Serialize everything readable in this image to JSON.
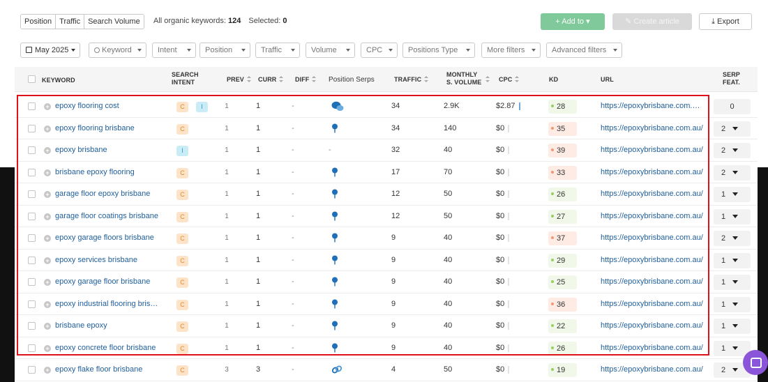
{
  "toolbar": {
    "tabs": [
      "Position",
      "Traffic",
      "Search Volume"
    ],
    "all_keywords_label": "All organic keywords:",
    "all_keywords_count": "124",
    "selected_label": "Selected:",
    "selected_count": "0",
    "add_label": "+ Add to ▾",
    "create_label": "✎ Create article",
    "export_label": "⤓ Export"
  },
  "filters": {
    "date": "May 2025",
    "keyword": "Keyword",
    "intent": "Intent",
    "position": "Position",
    "traffic": "Traffic",
    "volume": "Volume",
    "cpc": "CPC",
    "positions_type": "Positions Type",
    "more": "More filters",
    "advanced": "Advanced filters"
  },
  "columns": {
    "keyword": "KEYWORD",
    "intent_1": "SEARCH",
    "intent_2": "INTENT",
    "prev": "PREV",
    "curr": "CURR",
    "diff": "DIFF",
    "serps": "Position Serps",
    "traffic": "TRAFFIC",
    "volume_1": "MONTHLY",
    "volume_2": "S. VOLUME",
    "cpc": "CPC",
    "kd": "KD",
    "url": "URL",
    "serp_1": "SERP",
    "serp_2": "FEAT."
  },
  "rows": [
    {
      "keyword": "epoxy flooring cost",
      "intents": [
        "C",
        "I"
      ],
      "prev": "1",
      "curr": "1",
      "diff": "-",
      "serp_icon": "chat-icon",
      "traffic": "34",
      "volume": "2.9K",
      "cpc": "$2.87",
      "kd": "28",
      "kd_level": "g",
      "url": "https://epoxybrisbane.com.au/...",
      "serp_features": "0"
    },
    {
      "keyword": "epoxy flooring brisbane",
      "intents": [
        "C"
      ],
      "prev": "1",
      "curr": "1",
      "diff": "-",
      "serp_icon": "pin-icon",
      "traffic": "34",
      "volume": "140",
      "cpc": "$0",
      "kd": "35",
      "kd_level": "r",
      "url": "https://epoxybrisbane.com.au/",
      "serp_features": "2"
    },
    {
      "keyword": "epoxy brisbane",
      "intents": [
        "I"
      ],
      "prev": "1",
      "curr": "1",
      "diff": "-",
      "serp_icon": "none",
      "traffic": "32",
      "volume": "40",
      "cpc": "$0",
      "kd": "39",
      "kd_level": "r",
      "url": "https://epoxybrisbane.com.au/",
      "serp_features": "2"
    },
    {
      "keyword": "brisbane epoxy flooring",
      "intents": [
        "C"
      ],
      "prev": "1",
      "curr": "1",
      "diff": "-",
      "serp_icon": "pin-icon",
      "traffic": "17",
      "volume": "70",
      "cpc": "$0",
      "kd": "33",
      "kd_level": "r",
      "url": "https://epoxybrisbane.com.au/",
      "serp_features": "2"
    },
    {
      "keyword": "garage floor epoxy brisbane",
      "intents": [
        "C"
      ],
      "prev": "1",
      "curr": "1",
      "diff": "-",
      "serp_icon": "pin-icon",
      "traffic": "12",
      "volume": "50",
      "cpc": "$0",
      "kd": "26",
      "kd_level": "g",
      "url": "https://epoxybrisbane.com.au/",
      "serp_features": "1"
    },
    {
      "keyword": "garage floor coatings brisbane",
      "intents": [
        "C"
      ],
      "prev": "1",
      "curr": "1",
      "diff": "-",
      "serp_icon": "pin-icon",
      "traffic": "12",
      "volume": "50",
      "cpc": "$0",
      "kd": "27",
      "kd_level": "g",
      "url": "https://epoxybrisbane.com.au/",
      "serp_features": "1"
    },
    {
      "keyword": "epoxy garage floors brisbane",
      "intents": [
        "C"
      ],
      "prev": "1",
      "curr": "1",
      "diff": "-",
      "serp_icon": "pin-icon",
      "traffic": "9",
      "volume": "40",
      "cpc": "$0",
      "kd": "37",
      "kd_level": "r",
      "url": "https://epoxybrisbane.com.au/",
      "serp_features": "2"
    },
    {
      "keyword": "epoxy services brisbane",
      "intents": [
        "C"
      ],
      "prev": "1",
      "curr": "1",
      "diff": "-",
      "serp_icon": "pin-icon",
      "traffic": "9",
      "volume": "40",
      "cpc": "$0",
      "kd": "29",
      "kd_level": "g",
      "url": "https://epoxybrisbane.com.au/",
      "serp_features": "1"
    },
    {
      "keyword": "epoxy garage floor brisbane",
      "intents": [
        "C"
      ],
      "prev": "1",
      "curr": "1",
      "diff": "-",
      "serp_icon": "pin-icon",
      "traffic": "9",
      "volume": "40",
      "cpc": "$0",
      "kd": "25",
      "kd_level": "g",
      "url": "https://epoxybrisbane.com.au/",
      "serp_features": "1"
    },
    {
      "keyword": "epoxy industrial flooring brisbane",
      "intents": [
        "C"
      ],
      "prev": "1",
      "curr": "1",
      "diff": "-",
      "serp_icon": "pin-icon",
      "traffic": "9",
      "volume": "40",
      "cpc": "$0",
      "kd": "36",
      "kd_level": "r",
      "url": "https://epoxybrisbane.com.au/",
      "serp_features": "1"
    },
    {
      "keyword": "brisbane epoxy",
      "intents": [
        "C"
      ],
      "prev": "1",
      "curr": "1",
      "diff": "-",
      "serp_icon": "pin-icon",
      "traffic": "9",
      "volume": "40",
      "cpc": "$0",
      "kd": "22",
      "kd_level": "g",
      "url": "https://epoxybrisbane.com.au/",
      "serp_features": "1"
    },
    {
      "keyword": "epoxy concrete floor brisbane",
      "intents": [
        "C"
      ],
      "prev": "1",
      "curr": "1",
      "diff": "-",
      "serp_icon": "pin-icon",
      "traffic": "9",
      "volume": "40",
      "cpc": "$0",
      "kd": "26",
      "kd_level": "g",
      "url": "https://epoxybrisbane.com.au/",
      "serp_features": "1"
    },
    {
      "keyword": "epoxy flake floor brisbane",
      "intents": [
        "C"
      ],
      "prev": "3",
      "curr": "3",
      "diff": "-",
      "serp_icon": "link-icon",
      "traffic": "4",
      "volume": "50",
      "cpc": "$0",
      "kd": "19",
      "kd_level": "g",
      "url": "https://epoxybrisbane.com.au/",
      "serp_features": "2"
    }
  ],
  "colors": {
    "highlight_border": "#e0101a",
    "link": "#1f5e9a",
    "add_button": "#7fc99a",
    "chat_bubble": "#8a55d8"
  }
}
